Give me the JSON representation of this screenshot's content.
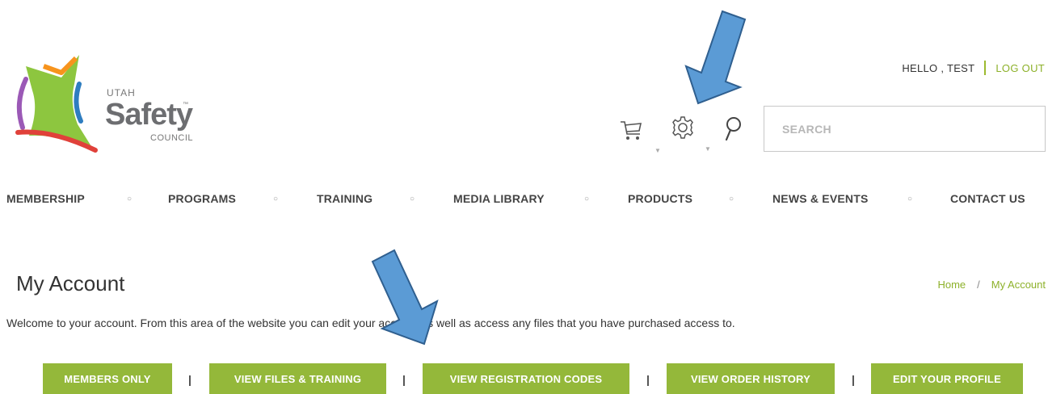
{
  "logo": {
    "line1": "UTAH",
    "line2": "Safety",
    "trademark": "™",
    "line3": "COUNCIL",
    "colors": {
      "green": "#8dc63f",
      "orange": "#f7941d",
      "purple": "#9b59b6",
      "blue": "#2e7dc0",
      "red": "#e0413a"
    }
  },
  "header": {
    "greeting": "HELLO , TEST",
    "logout_label": "LOG OUT",
    "cart_icon": "cart-icon",
    "settings_icon": "gear-icon",
    "search_icon": "search-icon",
    "search_placeholder": "SEARCH"
  },
  "nav": {
    "items": [
      "MEMBERSHIP",
      "PROGRAMS",
      "TRAINING",
      "MEDIA LIBRARY",
      "PRODUCTS",
      "NEWS & EVENTS",
      "CONTACT US"
    ],
    "separator": "○"
  },
  "page": {
    "title": "My Account",
    "breadcrumb": [
      "Home",
      "My Account"
    ],
    "breadcrumb_separator": "/",
    "welcome": "Welcome to your account. From this area of the website you can edit your account as well as access any files that you have purchased access to."
  },
  "account_buttons": {
    "items": [
      "MEMBERS ONLY",
      "VIEW FILES & TRAINING",
      "VIEW REGISTRATION CODES",
      "VIEW ORDER HISTORY",
      "EDIT YOUR PROFILE"
    ],
    "separator": "|"
  },
  "colors": {
    "accent_green": "#94b83a",
    "link_green": "#8db12a",
    "arrow_blue": "#5b9bd5"
  }
}
